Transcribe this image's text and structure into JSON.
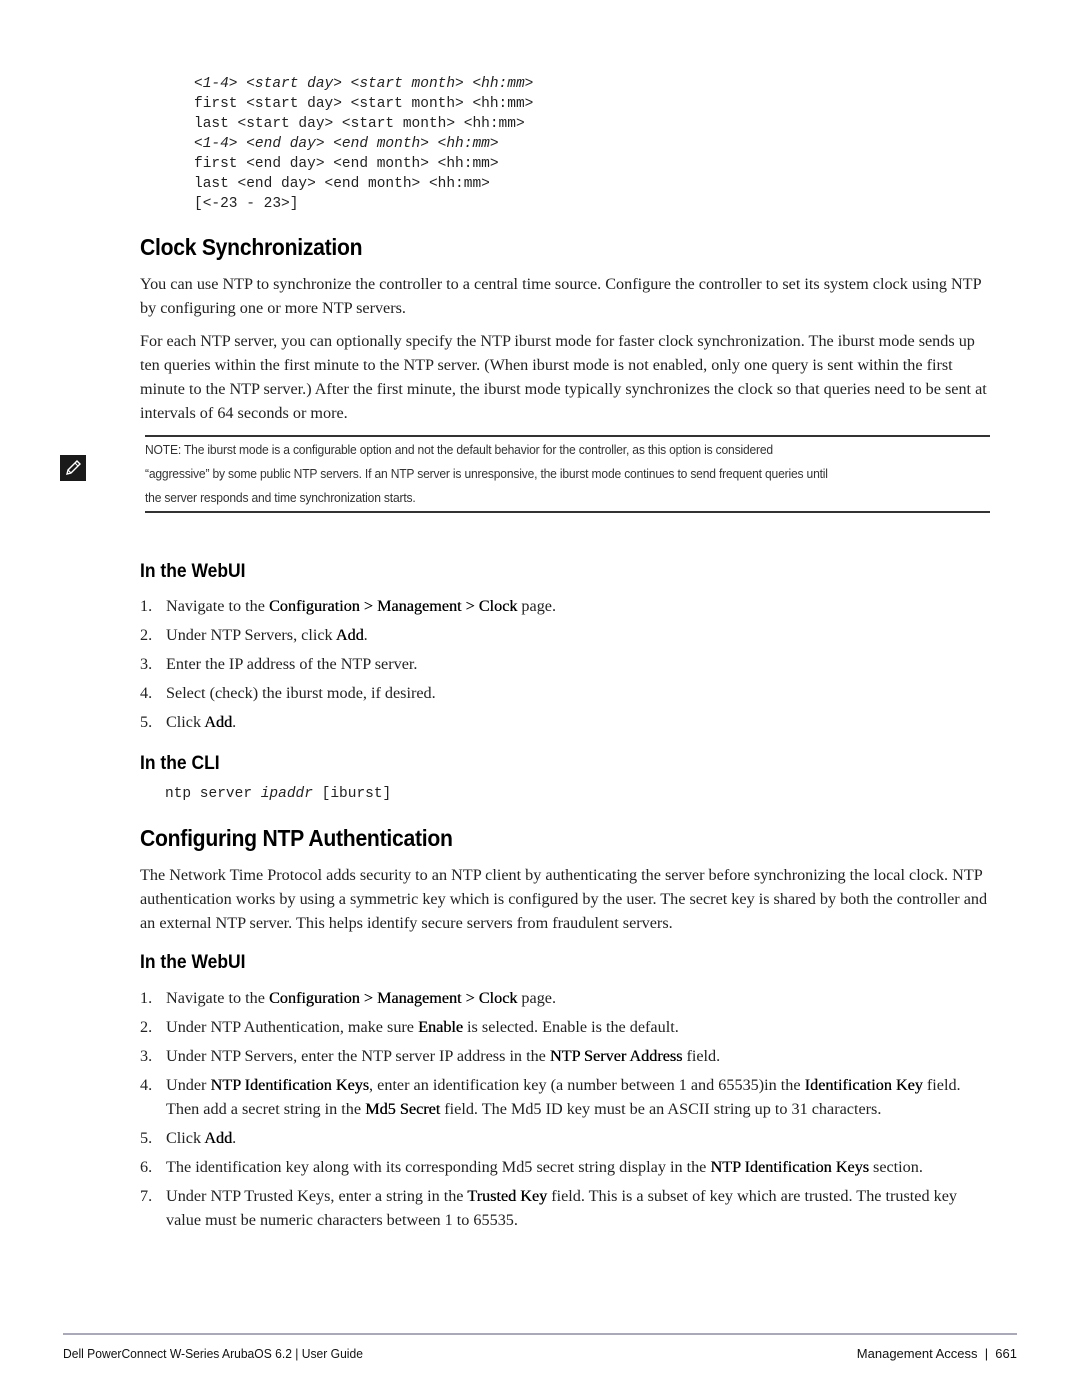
{
  "code_block": {
    "lines": [
      "<1-4> <start day> <start month> <hh:mm>",
      "first <start day> <start month> <hh:mm>",
      "last <start day> <start month> <hh:mm>",
      "<1-4> <end day> <end month> <hh:mm>",
      "first <end day> <end month> <hh:mm>",
      "last <end day> <end month> <hh:mm>",
      "[<-23 - 23>]"
    ]
  },
  "clock_sync": {
    "heading": "Clock Synchronization",
    "paragraphs": [
      "You can use NTP to synchronize the controller to a central time source. Configure the controller to set its system clock using NTP by configuring one or more NTP servers.",
      "For each NTP server, you can optionally specify the NTP iburst mode for faster clock synchronization. The iburst mode sends up ten queries within the first minute to the NTP server. (When iburst mode is not enabled, only one query is sent within the first minute to the NTP server.) After the first minute, the iburst mode typically synchronizes the clock so that queries need to be sent at intervals of 64 seconds or more."
    ],
    "note": {
      "icon": "pencil-note-icon",
      "lines": [
        "NOTE: The iburst mode is a configurable option and not the default behavior for the controller, as this option is considered",
        "“aggressive” by some public NTP servers. If an NTP server is unresponsive, the iburst mode continues to send frequent queries until",
        "the server responds and time synchronization starts."
      ]
    },
    "webui": {
      "heading": "In the WebUI",
      "steps": [
        {
          "num": "1.",
          "pre": "Navigate to the ",
          "bold": "Configuration > Management > Clock",
          "post": " page."
        },
        {
          "num": "2.",
          "pre": "Under NTP Servers, click ",
          "bold": "Add",
          "post": "."
        },
        {
          "num": "3.",
          "pre": "Enter the IP address of the NTP server.",
          "bold": "",
          "post": ""
        },
        {
          "num": "4.",
          "pre": "Select (check) the iburst mode, if desired.",
          "bold": "",
          "post": ""
        },
        {
          "num": "5.",
          "pre": "Click ",
          "bold": "Add",
          "post": "."
        }
      ]
    },
    "cli": {
      "heading": "In the CLI",
      "command_prefix": "ntp server ",
      "command_arg": "ipaddr",
      "command_suffix": " [iburst]"
    }
  },
  "ntp_auth": {
    "heading": "Configuring NTP Authentication",
    "paragraph": "The Network Time Protocol adds security to an NTP client by authenticating the server before synchronizing the local clock. NTP authentication works by using a symmetric key which is configured by the user. The secret key is shared by both the controller and an external NTP server. This helps identify secure servers from fraudulent servers.",
    "webui": {
      "heading": "In the WebUI",
      "steps": [
        {
          "num": "1.",
          "parts": [
            [
              "t",
              "Navigate to the "
            ],
            [
              "b",
              "Configuration > Management > Clock"
            ],
            [
              "t",
              " page."
            ]
          ]
        },
        {
          "num": "2.",
          "parts": [
            [
              "t",
              "Under NTP Authentication, make sure "
            ],
            [
              "b",
              "Enable"
            ],
            [
              "t",
              " is selected. Enable is the default."
            ]
          ]
        },
        {
          "num": "3.",
          "parts": [
            [
              "t",
              "Under NTP Servers, enter the NTP server IP address in the "
            ],
            [
              "b",
              "NTP Server Address"
            ],
            [
              "t",
              " field."
            ]
          ]
        },
        {
          "num": "4.",
          "parts": [
            [
              "t",
              "Under "
            ],
            [
              "b",
              "NTP Identification Keys"
            ],
            [
              "t",
              ", enter an identification key (a number between 1 and 65535)in the "
            ],
            [
              "b",
              "Identification Key"
            ],
            [
              "t",
              " field. Then add a secret string in the "
            ],
            [
              "b",
              "Md5 Secret"
            ],
            [
              "t",
              " field. The Md5 ID key must be an ASCII string up to 31 characters."
            ]
          ]
        },
        {
          "num": "5.",
          "parts": [
            [
              "t",
              "Click "
            ],
            [
              "b",
              "Add"
            ],
            [
              "t",
              "."
            ]
          ]
        },
        {
          "num": "6.",
          "parts": [
            [
              "t",
              "The identification key along with its corresponding Md5 secret string display in the "
            ],
            [
              "b",
              "NTP Identification Keys"
            ],
            [
              "t",
              " section."
            ]
          ]
        },
        {
          "num": "7.",
          "parts": [
            [
              "t",
              "Under NTP Trusted Keys, enter a string in the "
            ],
            [
              "b",
              "Trusted Key"
            ],
            [
              "t",
              " field. This is a subset of key which are trusted. The trusted key value must be numeric characters between 1 to 65535."
            ]
          ]
        }
      ]
    }
  },
  "footer": {
    "left": "Dell PowerConnect W-Series ArubaOS 6.2 | User Guide",
    "right": "Management Access  |  661"
  }
}
